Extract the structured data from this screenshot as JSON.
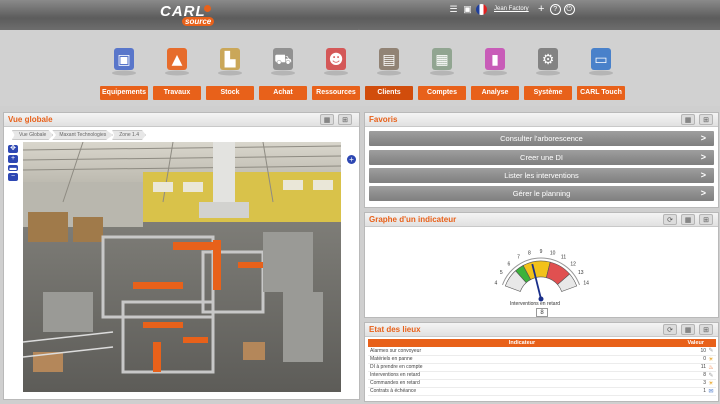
{
  "header": {
    "logo_main": "CARL",
    "logo_sub": "source",
    "user": "Jean Factory"
  },
  "menu": [
    {
      "label": "Equipements",
      "icon": "equipment-cubes-icon",
      "color": "#4b6cc9"
    },
    {
      "label": "Travaux",
      "icon": "traffic-cone-icon",
      "color": "#e8611a"
    },
    {
      "label": "Stock",
      "icon": "forklift-icon",
      "color": "#c9a24b"
    },
    {
      "label": "Achat",
      "icon": "shopping-cart-icon",
      "color": "#8a8a8a"
    },
    {
      "label": "Ressources",
      "icon": "people-icon",
      "color": "#d44a4a"
    },
    {
      "label": "Clients",
      "icon": "building-icon",
      "color": "#8a7a6a"
    },
    {
      "label": "Comptes",
      "icon": "calculator-icon",
      "color": "#8aa08a"
    },
    {
      "label": "Analyse",
      "icon": "bar-chart-icon",
      "color": "#c64fb5"
    },
    {
      "label": "Système",
      "icon": "gears-icon",
      "color": "#7a7a7a"
    },
    {
      "label": "CARL Touch",
      "icon": "tablet-icon",
      "color": "#3a78c9"
    }
  ],
  "vue_globale": {
    "title": "Vue globale",
    "breadcrumb": [
      "Vue Globale",
      "Maxant Technologies",
      "Zone 1.4"
    ]
  },
  "favoris": {
    "title": "Favoris",
    "items": [
      "Consulter l'arborescence",
      "Creer une DI",
      "Lister les interventions",
      "Gérer le planning"
    ]
  },
  "graphe": {
    "title": "Graphe d'un indicateur",
    "gauge_label": "Interventions en retard",
    "value": "8",
    "ticks": [
      "4",
      "5",
      "6",
      "7",
      "8",
      "9",
      "10",
      "11",
      "12",
      "13",
      "14"
    ],
    "colors": {
      "green": "#3bb33b",
      "yellow": "#f2c21a",
      "red": "#e05050"
    }
  },
  "etat": {
    "title": "Etat des lieux",
    "col_indicateur": "Indicateur",
    "col_valeur": "Valeur",
    "rows": [
      {
        "name": "Alarmes sur convoyeur",
        "value": "10",
        "icon": "wrench-icon"
      },
      {
        "name": "Matériels en panne",
        "value": "0",
        "icon": "sun-warning-icon"
      },
      {
        "name": "DI à prendre en compte",
        "value": "11",
        "icon": "flame-icon"
      },
      {
        "name": "Interventions en retard",
        "value": "8",
        "icon": "wrench-icon"
      },
      {
        "name": "Commandes en retard",
        "value": "3",
        "icon": "sun-warning-icon"
      },
      {
        "name": "Contrats à échéance",
        "value": "1",
        "icon": "contract-icon"
      }
    ]
  }
}
